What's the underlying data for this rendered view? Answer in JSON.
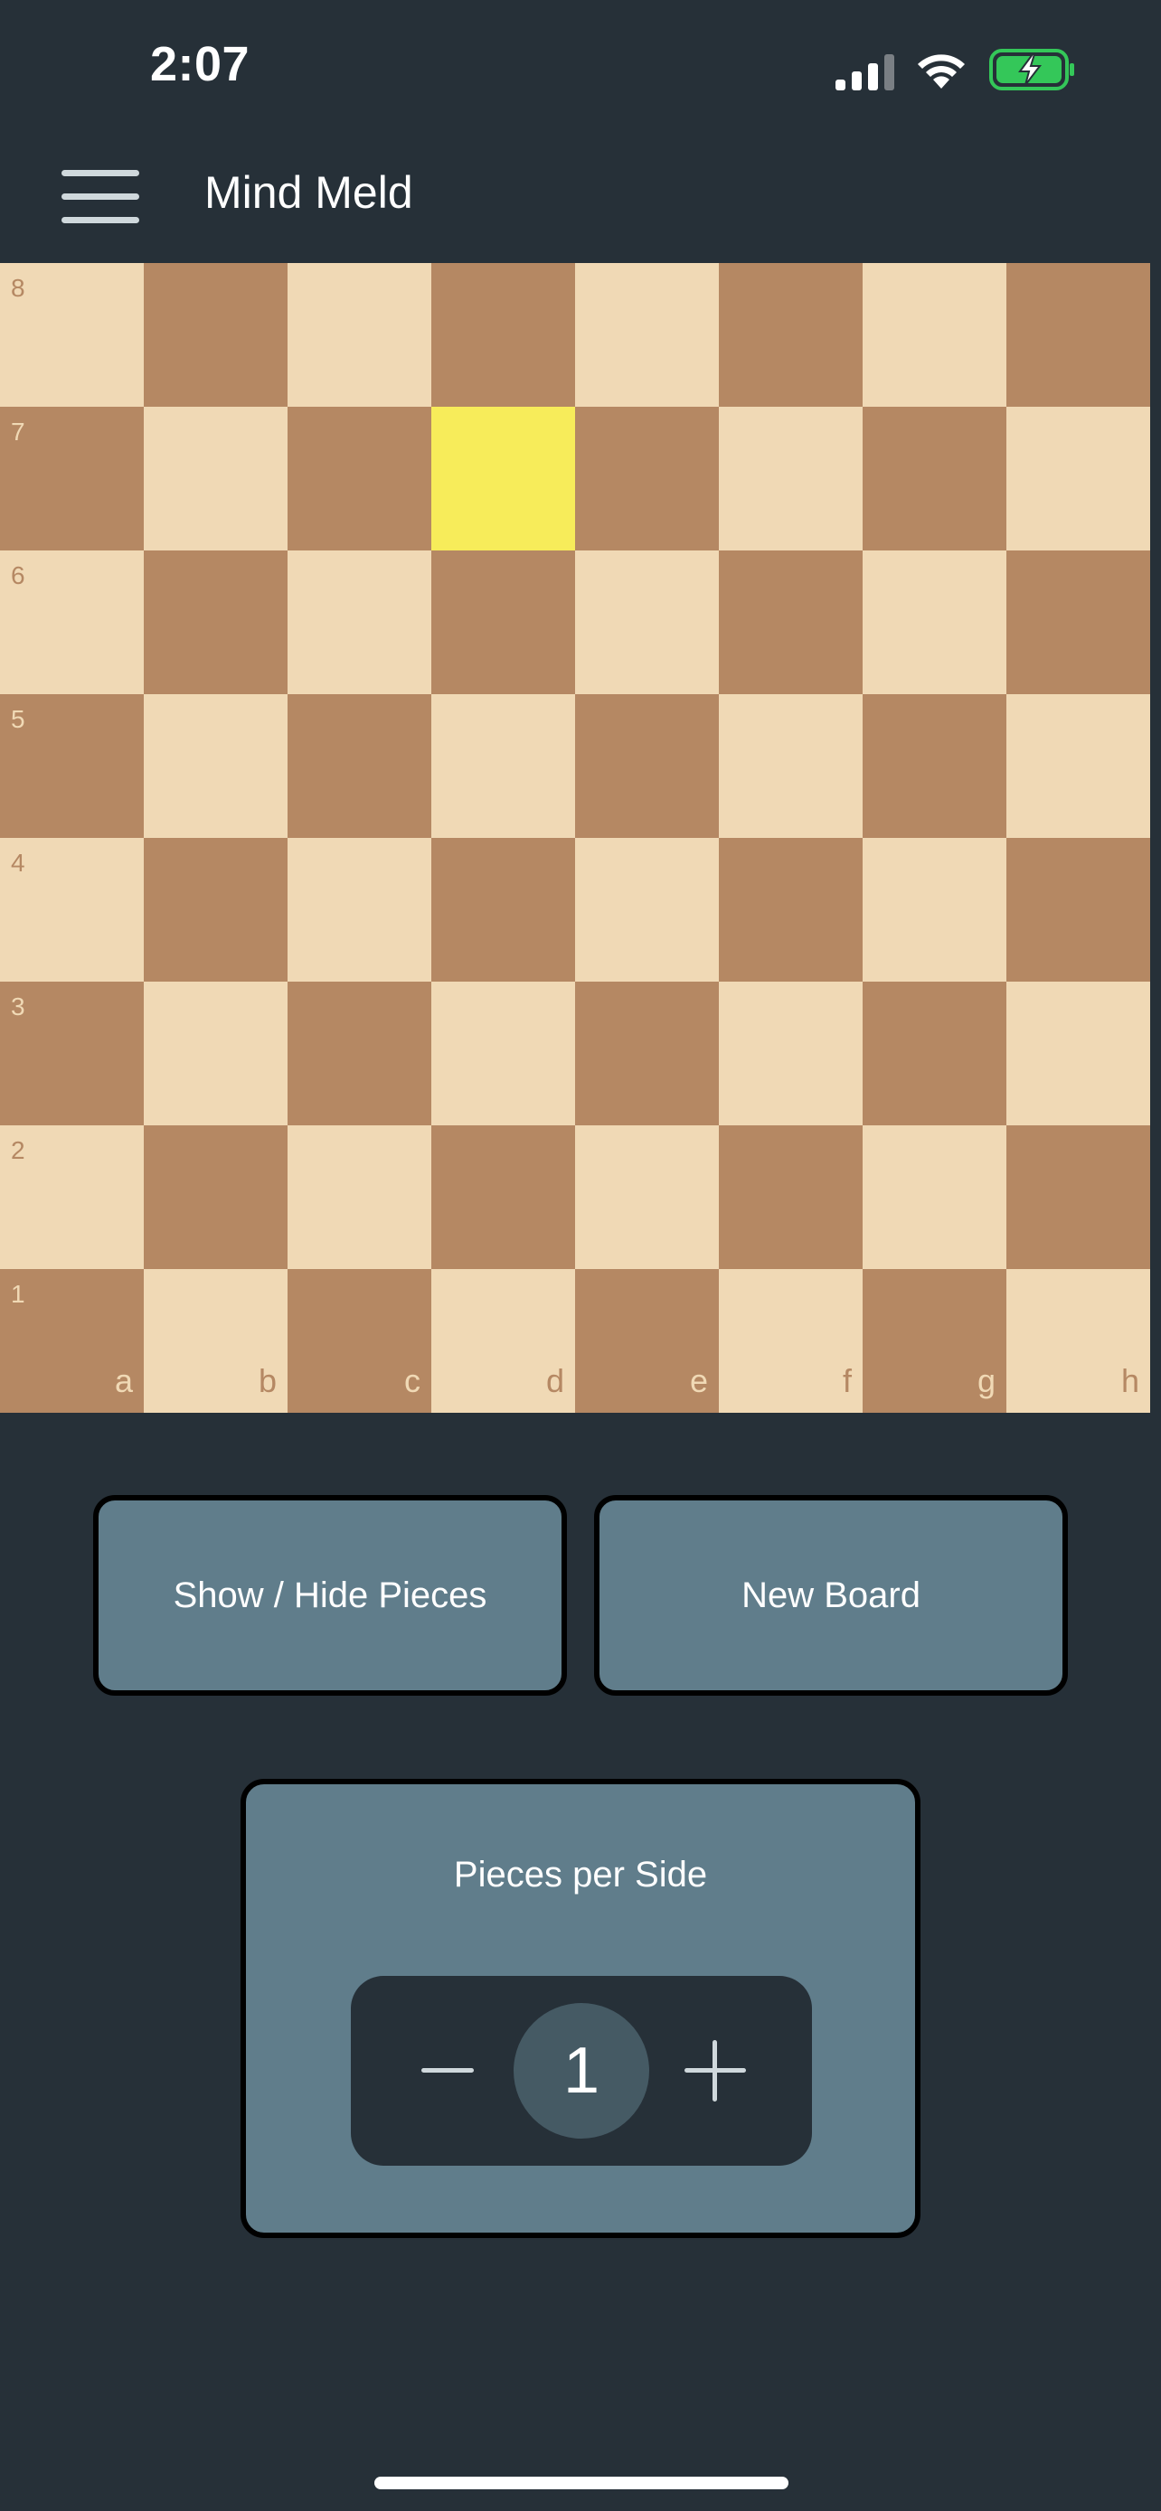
{
  "status_bar": {
    "time": "2:07",
    "signal_icon": "cellular-signal-icon",
    "wifi_icon": "wifi-icon",
    "battery_icon": "battery-charging-icon",
    "battery_color": "#34c759"
  },
  "header": {
    "menu_icon": "hamburger-menu-icon",
    "title": "Mind Meld"
  },
  "board": {
    "ranks": [
      "8",
      "7",
      "6",
      "5",
      "4",
      "3",
      "2",
      "1"
    ],
    "files": [
      "a",
      "b",
      "c",
      "d",
      "e",
      "f",
      "g",
      "h"
    ],
    "highlighted_square": "d7",
    "light_color": "#f0d9b5",
    "dark_color": "#b58863",
    "highlight_color": "#f7ec5a"
  },
  "buttons": {
    "show_hide_label": "Show / Hide Pieces",
    "new_board_label": "New Board"
  },
  "pieces_per_side": {
    "label": "Pieces per Side",
    "value": "1",
    "decrement_icon": "minus-icon",
    "increment_icon": "plus-icon"
  },
  "colors": {
    "background": "#263038",
    "button": "#607d8b",
    "border": "#000000"
  }
}
